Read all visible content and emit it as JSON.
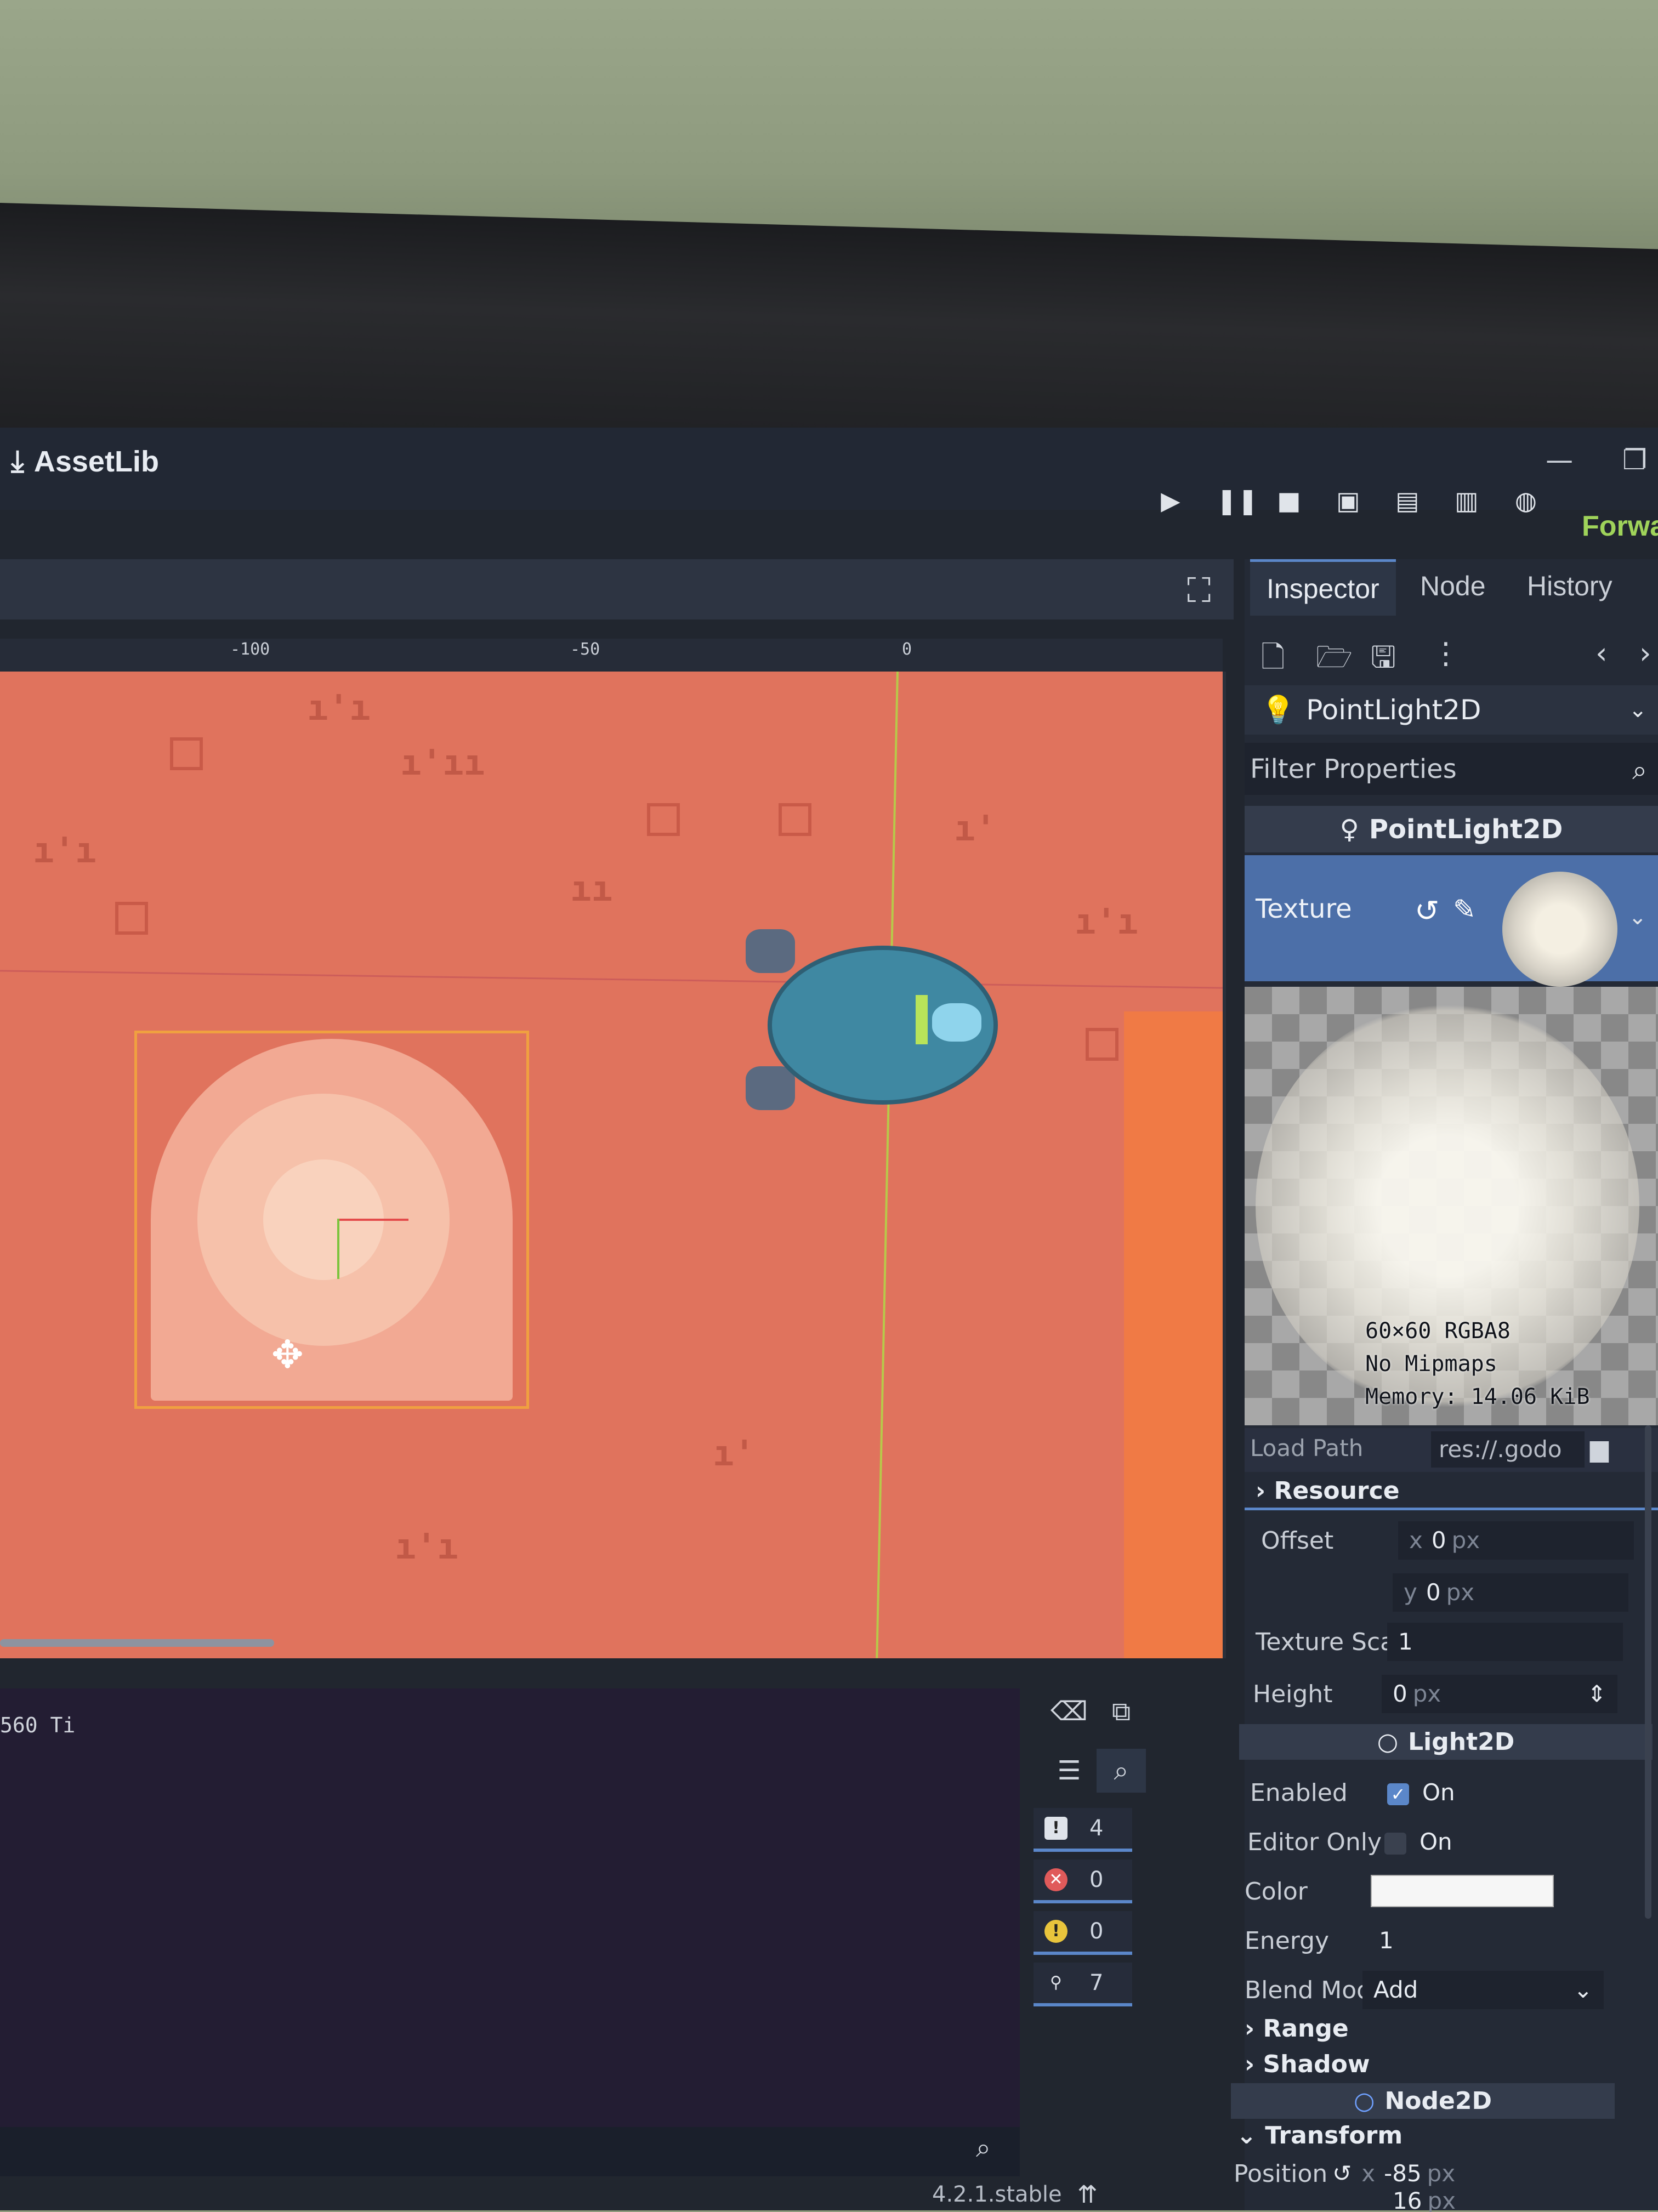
{
  "titlebar": {
    "assetlib_label": "AssetLib",
    "renderer_label": "Forwa"
  },
  "viewport": {
    "ruler_labels": [
      "-100",
      "-50",
      "0"
    ]
  },
  "output": {
    "text_line": "560 Ti",
    "counters": [
      {
        "type": "messages",
        "count": "4"
      },
      {
        "type": "errors",
        "count": "0"
      },
      {
        "type": "warnings",
        "count": "0"
      },
      {
        "type": "editor",
        "count": "7"
      }
    ]
  },
  "status_bar": {
    "version": "4.2.1.stable"
  },
  "inspector": {
    "tabs": [
      "Inspector",
      "Node",
      "History"
    ],
    "node_selector": "PointLight2D",
    "filter_placeholder": "Filter Properties",
    "class_header": "PointLight2D",
    "texture_label": "Texture",
    "texture_info": [
      "60×60 RGBA8",
      "No Mipmaps",
      "Memory: 14.06 KiB"
    ],
    "load_path_label": "Load Path",
    "load_path_value": "res://.godo",
    "resource_label": "Resource",
    "offset": {
      "label": "Offset",
      "x_tag": "x",
      "x": "0",
      "y_tag": "y",
      "y": "0",
      "unit": "px"
    },
    "texture_scale": {
      "label": "Texture Scale",
      "value": "1"
    },
    "height": {
      "label": "Height",
      "value": "0",
      "unit": "px"
    },
    "light2d_header": "Light2D",
    "enabled": {
      "label": "Enabled",
      "value": "On"
    },
    "editor_only": {
      "label": "Editor Only",
      "value": "On"
    },
    "color_label": "Color",
    "energy": {
      "label": "Energy",
      "value": "1"
    },
    "blend_mode": {
      "label": "Blend Mode",
      "value": "Add"
    },
    "range_label": "Range",
    "shadow_label": "Shadow",
    "node2d_header": "Node2D",
    "transform_label": "Transform",
    "position": {
      "label": "Position",
      "x_tag": "x",
      "x": "-85",
      "y": "16",
      "unit": "px"
    }
  },
  "colors": {
    "accent": "#5b87c9",
    "canvas_bg": "#e0735d",
    "renderer": "#9fd35a"
  }
}
